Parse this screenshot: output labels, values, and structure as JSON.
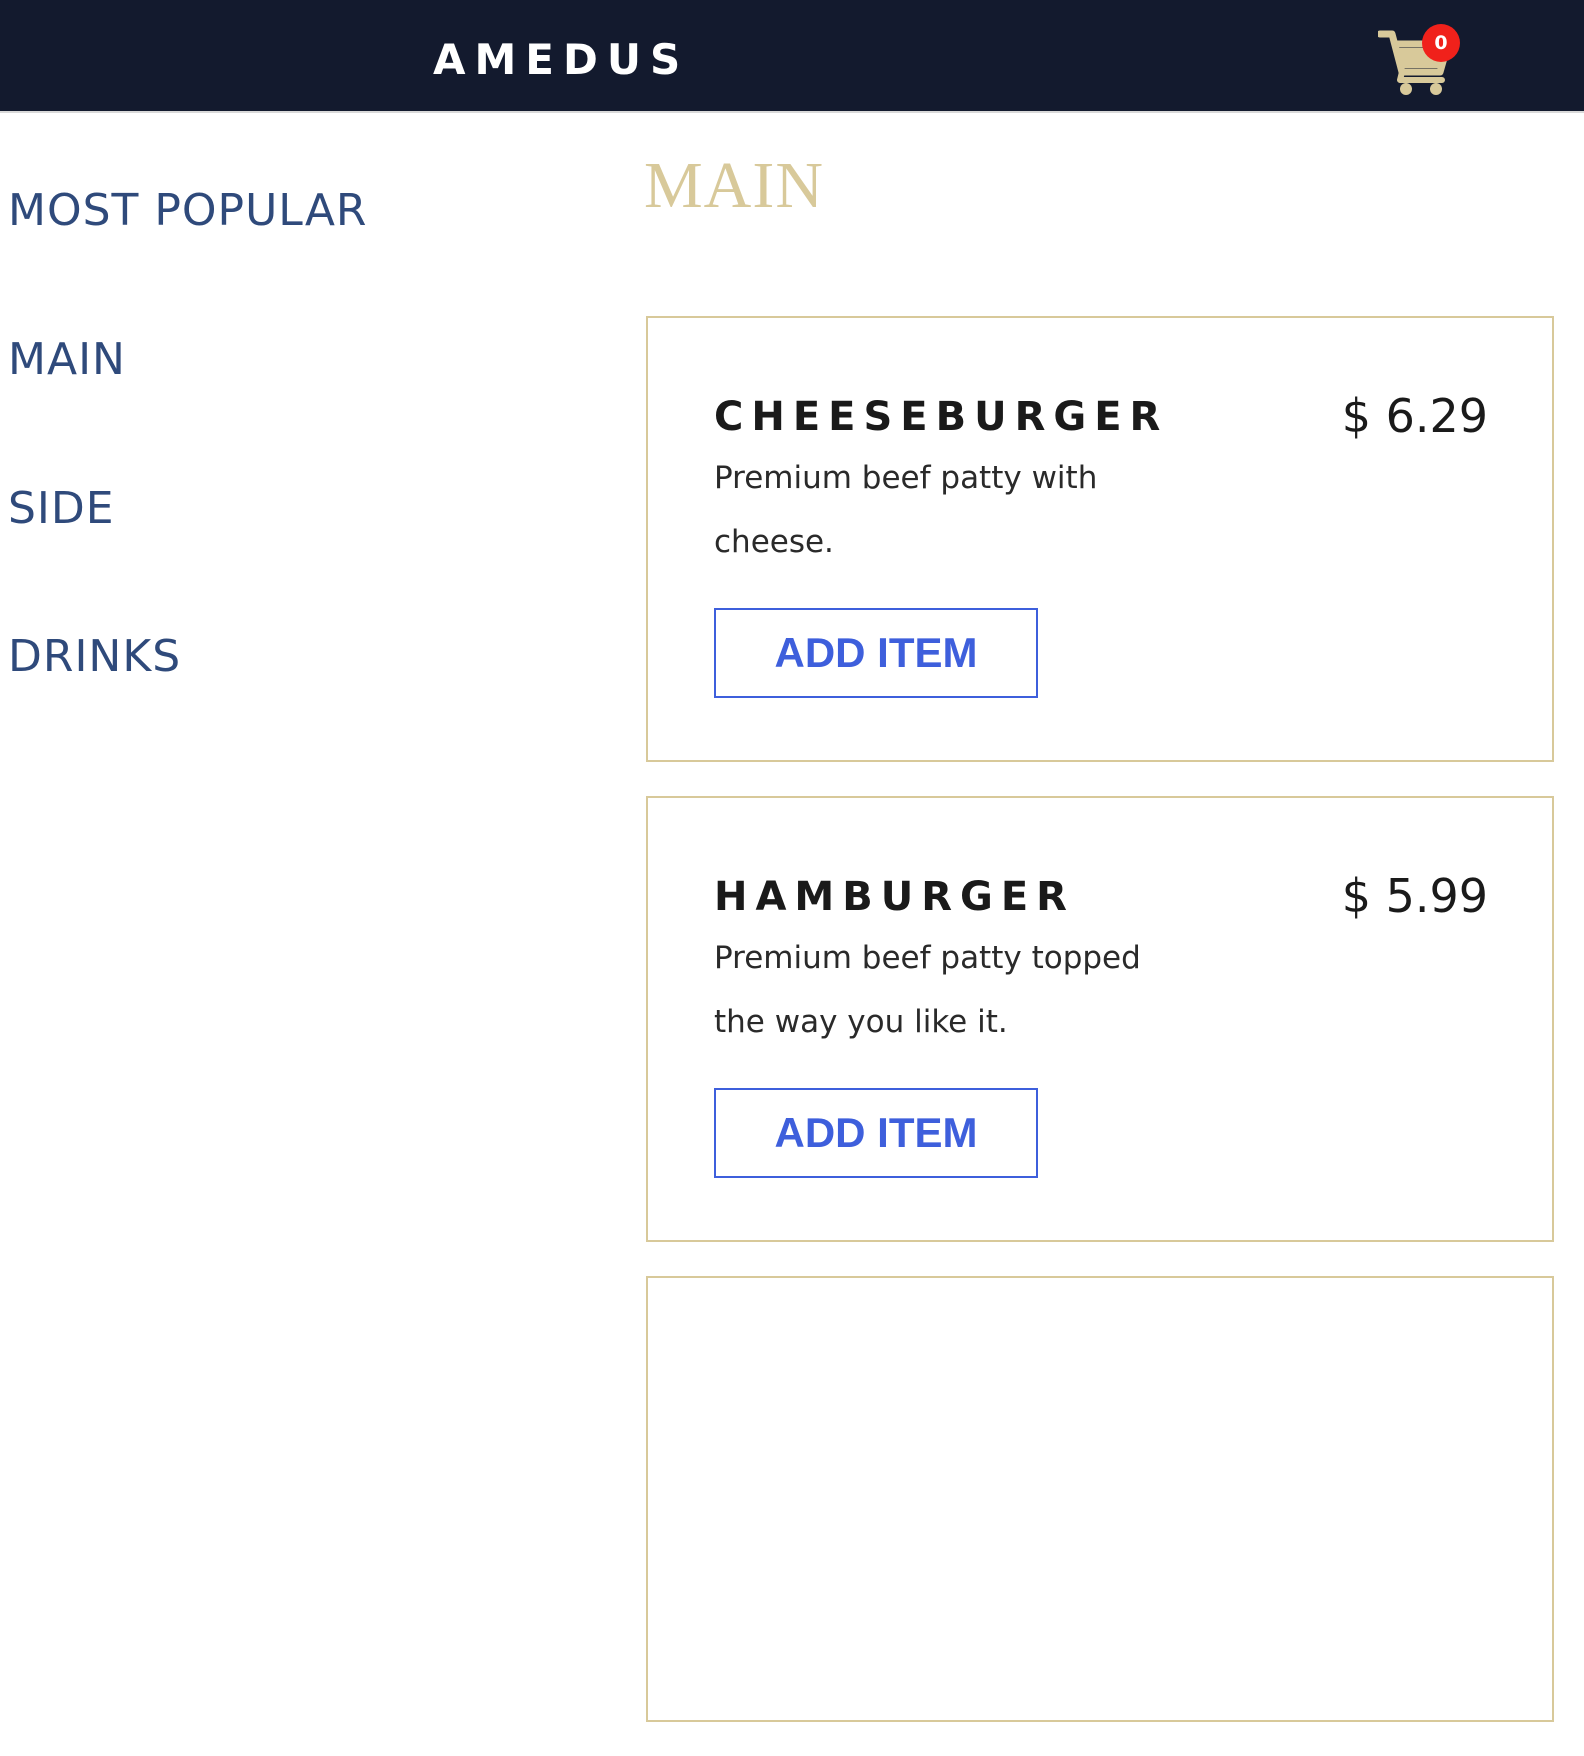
{
  "header": {
    "brand": "AMEDUS",
    "cart_count": "0"
  },
  "sidebar": {
    "items": [
      {
        "label": "MOST POPULAR"
      },
      {
        "label": "MAIN"
      },
      {
        "label": "SIDE"
      },
      {
        "label": "DRINKS"
      }
    ]
  },
  "main": {
    "section_title": "MAIN",
    "items": [
      {
        "name": "CHEESEBURGER",
        "price": "$ 6.29",
        "description": "Premium beef patty with cheese.",
        "button_label": "ADD ITEM"
      },
      {
        "name": "HAMBURGER",
        "price": "$ 5.99",
        "description": "Premium beef patty topped the way you like it.",
        "button_label": "ADD ITEM"
      }
    ]
  },
  "colors": {
    "header_bg": "#131a2e",
    "accent_gold": "#d8c99a",
    "nav_blue": "#2f4a7b",
    "button_blue": "#3e5fdc",
    "badge_red": "#f0211b"
  },
  "icons": {
    "cart": "shopping-cart-icon"
  }
}
